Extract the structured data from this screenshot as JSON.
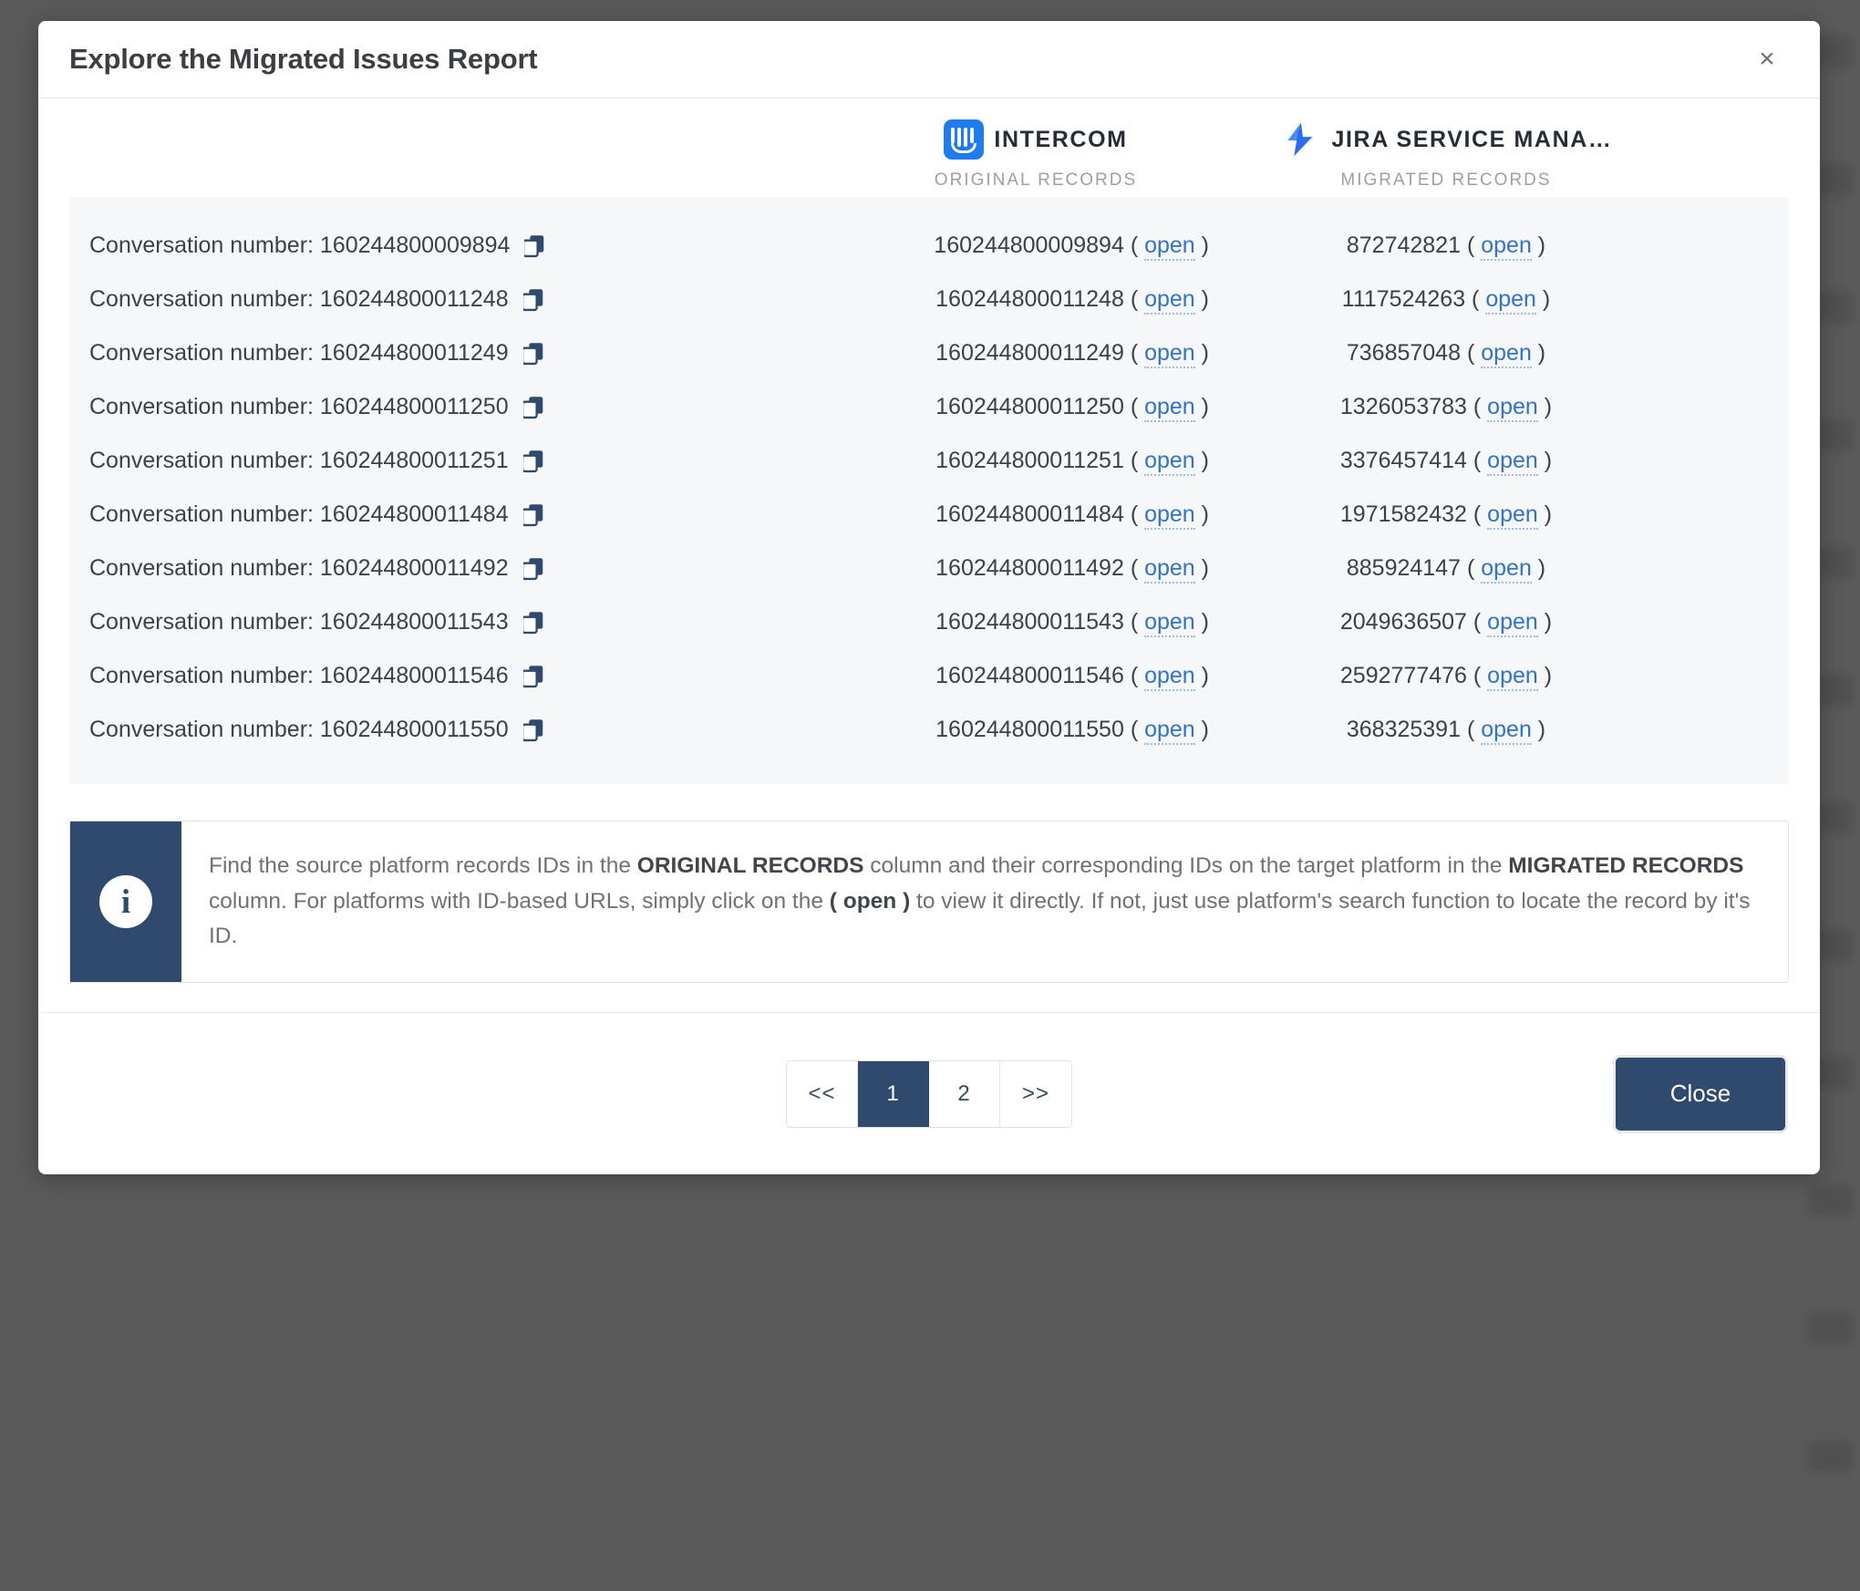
{
  "modal": {
    "title": "Explore the Migrated Issues Report",
    "close_icon": "close-icon",
    "close_glyph": "×"
  },
  "platforms": {
    "source": {
      "name": "INTERCOM",
      "sublabel": "ORIGINAL RECORDS",
      "icon": "intercom-logo",
      "color": "#1f7ced"
    },
    "target": {
      "name": "JIRA SERVICE MANA…",
      "sublabel": "MIGRATED RECORDS",
      "icon": "jira-service-management-logo",
      "color": "#2a6ef0"
    }
  },
  "table": {
    "open_label": "open",
    "paren_open": "(",
    "paren_close": ")",
    "rows": [
      {
        "source_label": "Conversation number: 160244800009894",
        "original_id": "160244800009894",
        "migrated_id": "872742821"
      },
      {
        "source_label": "Conversation number: 160244800011248",
        "original_id": "160244800011248",
        "migrated_id": "1117524263"
      },
      {
        "source_label": "Conversation number: 160244800011249",
        "original_id": "160244800011249",
        "migrated_id": "736857048"
      },
      {
        "source_label": "Conversation number: 160244800011250",
        "original_id": "160244800011250",
        "migrated_id": "1326053783"
      },
      {
        "source_label": "Conversation number: 160244800011251",
        "original_id": "160244800011251",
        "migrated_id": "3376457414"
      },
      {
        "source_label": "Conversation number: 160244800011484",
        "original_id": "160244800011484",
        "migrated_id": "1971582432"
      },
      {
        "source_label": "Conversation number: 160244800011492",
        "original_id": "160244800011492",
        "migrated_id": "885924147"
      },
      {
        "source_label": "Conversation number: 160244800011543",
        "original_id": "160244800011543",
        "migrated_id": "2049636507"
      },
      {
        "source_label": "Conversation number: 160244800011546",
        "original_id": "160244800011546",
        "migrated_id": "2592777476"
      },
      {
        "source_label": "Conversation number: 160244800011550",
        "original_id": "160244800011550",
        "migrated_id": "368325391"
      }
    ]
  },
  "info": {
    "icon": "info-icon",
    "icon_glyph": "i",
    "part1": "Find the source platform records IDs in the ",
    "strong1": "ORIGINAL RECORDS",
    "part2": " column and their corresponding IDs on the target platform in the ",
    "strong2": "MIGRATED RECORDS",
    "part3": " column. For platforms with ID-based URLs, simply click on the ",
    "strong3": "( open )",
    "part4": " to view it directly. If not, just use platform's search function to locate the record by it's ID."
  },
  "footer": {
    "pagination": {
      "first_label": "<<",
      "last_label": ">>",
      "pages": [
        "1",
        "2"
      ],
      "active_page": "1"
    },
    "close_label": "Close"
  },
  "colors": {
    "accent_navy": "#2f4a6d",
    "link_blue": "#3273c8",
    "table_bg": "#f6f7f8",
    "overlay": "#5a5a5a"
  }
}
